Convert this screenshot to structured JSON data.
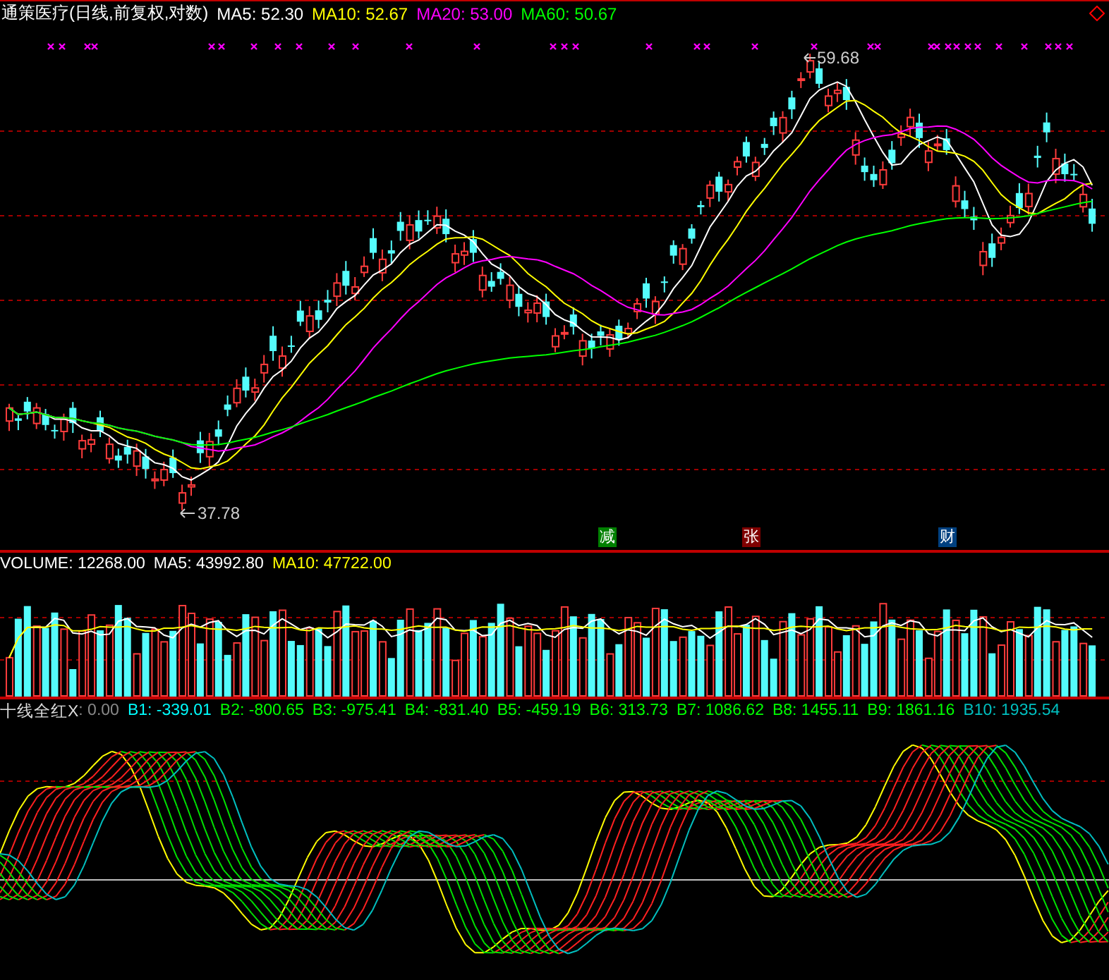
{
  "header": {
    "title": "通策医疗(日线,前复权,对数)",
    "averages": [
      {
        "label": "MA5: 52.30",
        "color": "#ffffff"
      },
      {
        "label": "MA10: 52.67",
        "color": "#ffff00"
      },
      {
        "label": "MA20: 53.00",
        "color": "#ff00ff"
      },
      {
        "label": "MA60: 50.67",
        "color": "#00ff00"
      }
    ]
  },
  "price_chart": {
    "high_label": "59.68",
    "low_label": "37.78",
    "event_markers": [
      {
        "text": "减",
        "color": "#008000"
      },
      {
        "text": "张",
        "color": "#800000"
      },
      {
        "text": "财",
        "color": "#004080"
      }
    ]
  },
  "volume_panel": {
    "legend": [
      {
        "label": "VOLUME: 12268.00",
        "color": "#ffffff"
      },
      {
        "label": "MA5: 43992.80",
        "color": "#ffffff"
      },
      {
        "label": "MA10: 47722.00",
        "color": "#ffff00"
      }
    ]
  },
  "indicator_panel": {
    "title": "十线全红X",
    "value": ": 0.00",
    "lines": [
      {
        "label": "B1: -339.01",
        "color": "#00ffff"
      },
      {
        "label": "B2: -800.65",
        "color": "#00ff00"
      },
      {
        "label": "B3: -975.41",
        "color": "#00ff00"
      },
      {
        "label": "B4: -831.40",
        "color": "#00ff00"
      },
      {
        "label": "B5: -459.19",
        "color": "#00ff00"
      },
      {
        "label": "B6: 313.73",
        "color": "#00ff00"
      },
      {
        "label": "B7: 1086.62",
        "color": "#00ff00"
      },
      {
        "label": "B8: 1455.11",
        "color": "#00ff00"
      },
      {
        "label": "B9: 1861.16",
        "color": "#00ff00"
      },
      {
        "label": "B10: 1935.54",
        "color": "#00c0c0"
      }
    ]
  }
}
